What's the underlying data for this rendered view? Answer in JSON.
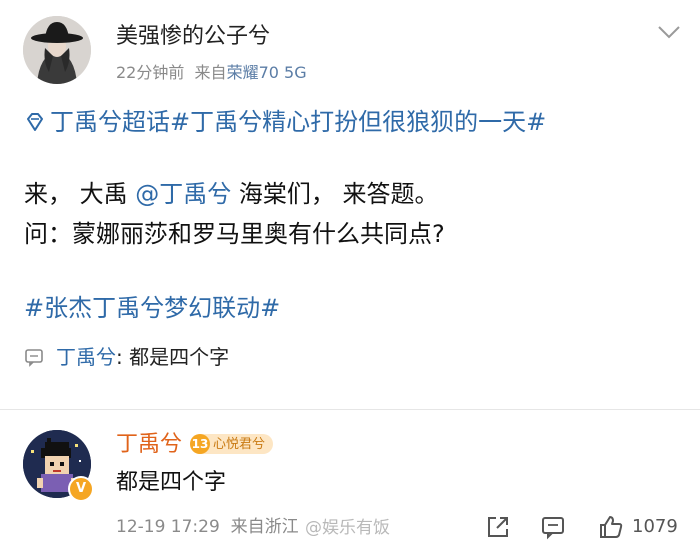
{
  "post": {
    "author": "美强惨的公子兮",
    "time": "22分钟前",
    "source_prefix": "来自",
    "device": "荣耀70 5G",
    "topic": "丁禹兮超话#丁禹兮精心打扮但很狼狈的一天#",
    "line1_a": "来， 大禹 ",
    "line1_mention": "@丁禹兮",
    "line1_b": " 海棠们， 来答题。",
    "line2": "问：蒙娜丽莎和罗马里奥有什么共同点?",
    "hashtag": "#张杰丁禹兮梦幻联动#",
    "quote_name": "丁禹兮",
    "quote_text": ": 都是四个字"
  },
  "comment": {
    "author": "丁禹兮",
    "level": "13",
    "fan_badge": "心悦君兮",
    "verified": "V",
    "text": "都是四个字",
    "date": "12-19 17:29",
    "source": "来自浙江",
    "like_count": "1079"
  },
  "watermark": "@娱乐有饭",
  "icons": [
    "chevron-down-icon",
    "super-topic-icon",
    "comment-bubble-icon",
    "share-icon",
    "reply-icon",
    "thumbs-up-icon"
  ],
  "colors": {
    "link": "#2f6aa8",
    "name_orange": "#e0631a",
    "meta_gray": "#8a8a8a"
  }
}
